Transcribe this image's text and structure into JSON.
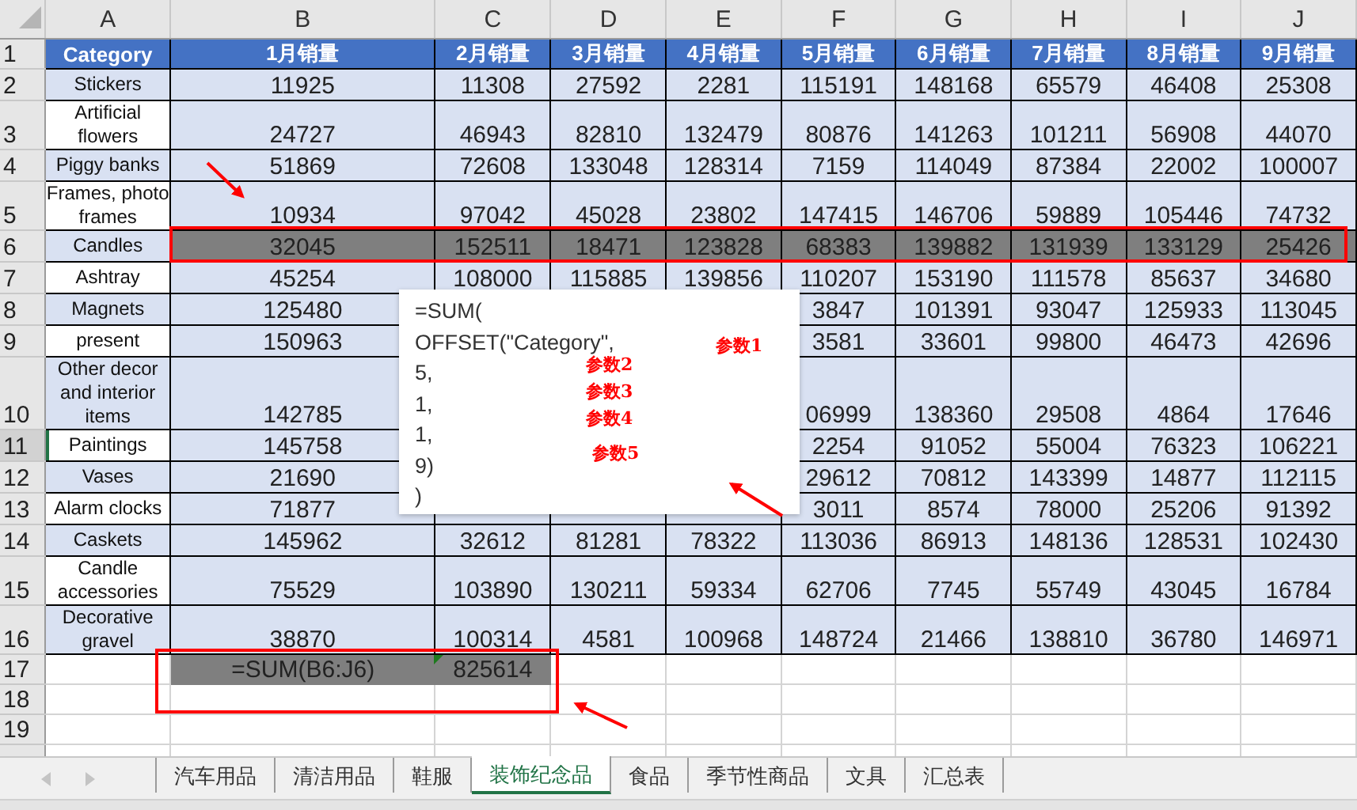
{
  "columns": [
    "A",
    "B",
    "C",
    "D",
    "E",
    "F",
    "G",
    "H",
    "I",
    "J"
  ],
  "header": {
    "num": "1",
    "cells": [
      "Category",
      "1月销量",
      "2月销量",
      "3月销量",
      "4月销量",
      "5月销量",
      "6月销量",
      "7月销量",
      "8月销量",
      "9月销量"
    ]
  },
  "rows": [
    {
      "num": "2",
      "category": "Stickers",
      "cells": {
        "B": "11925",
        "C": "11308",
        "D": "27592",
        "E": "2281",
        "F": "115191",
        "G": "148168",
        "H": "65579",
        "I": "46408",
        "J": "25308"
      },
      "highlighted": false,
      "selected": false
    },
    {
      "num": "3",
      "category": "Artificial flowers",
      "cells": {
        "B": "24727",
        "C": "46943",
        "D": "82810",
        "E": "132479",
        "F": "80876",
        "G": "141263",
        "H": "101211",
        "I": "56908",
        "J": "44070"
      },
      "highlighted": false,
      "selected": false
    },
    {
      "num": "4",
      "category": "Piggy banks",
      "cells": {
        "B": "51869",
        "C": "72608",
        "D": "133048",
        "E": "128314",
        "F": "7159",
        "G": "114049",
        "H": "87384",
        "I": "22002",
        "J": "100007"
      },
      "highlighted": false,
      "selected": false
    },
    {
      "num": "5",
      "category": "Frames, photo frames",
      "cells": {
        "B": "10934",
        "C": "97042",
        "D": "45028",
        "E": "23802",
        "F": "147415",
        "G": "146706",
        "H": "59889",
        "I": "105446",
        "J": "74732"
      },
      "highlighted": false,
      "selected": false
    },
    {
      "num": "6",
      "category": "Candles",
      "cells": {
        "B": "32045",
        "C": "152511",
        "D": "18471",
        "E": "123828",
        "F": "68383",
        "G": "139882",
        "H": "131939",
        "I": "133129",
        "J": "25426"
      },
      "highlighted": true,
      "selected": false
    },
    {
      "num": "7",
      "category": "Ashtray",
      "cells": {
        "B": "45254",
        "C": "108000",
        "D": "115885",
        "E": "139856",
        "F": "110207",
        "G": "153190",
        "H": "111578",
        "I": "85637",
        "J": "34680"
      },
      "highlighted": false,
      "selected": false
    },
    {
      "num": "8",
      "category": "Magnets",
      "cells": {
        "B": "125480",
        "F": "3847",
        "G": "101391",
        "H": "93047",
        "I": "125933",
        "J": "113045"
      },
      "highlighted": false,
      "selected": false
    },
    {
      "num": "9",
      "category": "present",
      "cells": {
        "B": "150963",
        "F": "3581",
        "G": "33601",
        "H": "99800",
        "I": "46473",
        "J": "42696"
      },
      "highlighted": false,
      "selected": false
    },
    {
      "num": "10",
      "category": "Other decor and interior items",
      "cells": {
        "B": "142785",
        "F": "06999",
        "G": "138360",
        "H": "29508",
        "I": "4864",
        "J": "17646"
      },
      "highlighted": false,
      "selected": false
    },
    {
      "num": "11",
      "category": "Paintings",
      "cells": {
        "B": "145758",
        "F": "2254",
        "G": "91052",
        "H": "55004",
        "I": "76323",
        "J": "106221"
      },
      "highlighted": false,
      "selected": true
    },
    {
      "num": "12",
      "category": "Vases",
      "cells": {
        "B": "21690",
        "F": "29612",
        "G": "70812",
        "H": "143399",
        "I": "14877",
        "J": "112115"
      },
      "highlighted": false,
      "selected": false
    },
    {
      "num": "13",
      "category": "Alarm clocks",
      "cells": {
        "B": "71877",
        "F": "3011",
        "G": "8574",
        "H": "78000",
        "I": "25206",
        "J": "91392"
      },
      "highlighted": false,
      "selected": false
    },
    {
      "num": "14",
      "category": "Caskets",
      "cells": {
        "B": "145962",
        "C": "32612",
        "D": "81281",
        "E": "78322",
        "F": "113036",
        "G": "86913",
        "H": "148136",
        "I": "128531",
        "J": "102430"
      },
      "highlighted": false,
      "selected": false
    },
    {
      "num": "15",
      "category": "Candle accessories",
      "cells": {
        "B": "75529",
        "C": "103890",
        "D": "130211",
        "E": "59334",
        "F": "62706",
        "G": "7745",
        "H": "55749",
        "I": "43045",
        "J": "16784"
      },
      "highlighted": false,
      "selected": false
    },
    {
      "num": "16",
      "category": "Decorative gravel",
      "cells": {
        "B": "38870",
        "C": "100314",
        "D": "4581",
        "E": "100968",
        "F": "148724",
        "G": "21466",
        "H": "138810",
        "I": "36780",
        "J": "146971"
      },
      "highlighted": false,
      "selected": false
    }
  ],
  "sum_row": {
    "num": "17",
    "formula": "=SUM(B6:J6)",
    "result": "825614"
  },
  "empty_rows": [
    "18",
    "19"
  ],
  "formula_popup": {
    "lines": [
      {
        "text": "=SUM("
      },
      {
        "text": "OFFSET(\"Category\",",
        "note": "参数1"
      },
      {
        "text": "5,",
        "note": "参数2"
      },
      {
        "text": "1,",
        "note": "参数3"
      },
      {
        "text": "1,",
        "note": "参数4"
      },
      {
        "text": "9)",
        "note": "参数5"
      },
      {
        "text": ")"
      }
    ]
  },
  "sheet_tabs": [
    {
      "label": "汽车用品",
      "selected": false
    },
    {
      "label": "清洁用品",
      "selected": false
    },
    {
      "label": "鞋服",
      "selected": false
    },
    {
      "label": "装饰纪念品",
      "selected": true
    },
    {
      "label": "食品",
      "selected": false
    },
    {
      "label": "季节性商品",
      "selected": false
    },
    {
      "label": "文具",
      "selected": false
    },
    {
      "label": "汇总表",
      "selected": false
    }
  ]
}
